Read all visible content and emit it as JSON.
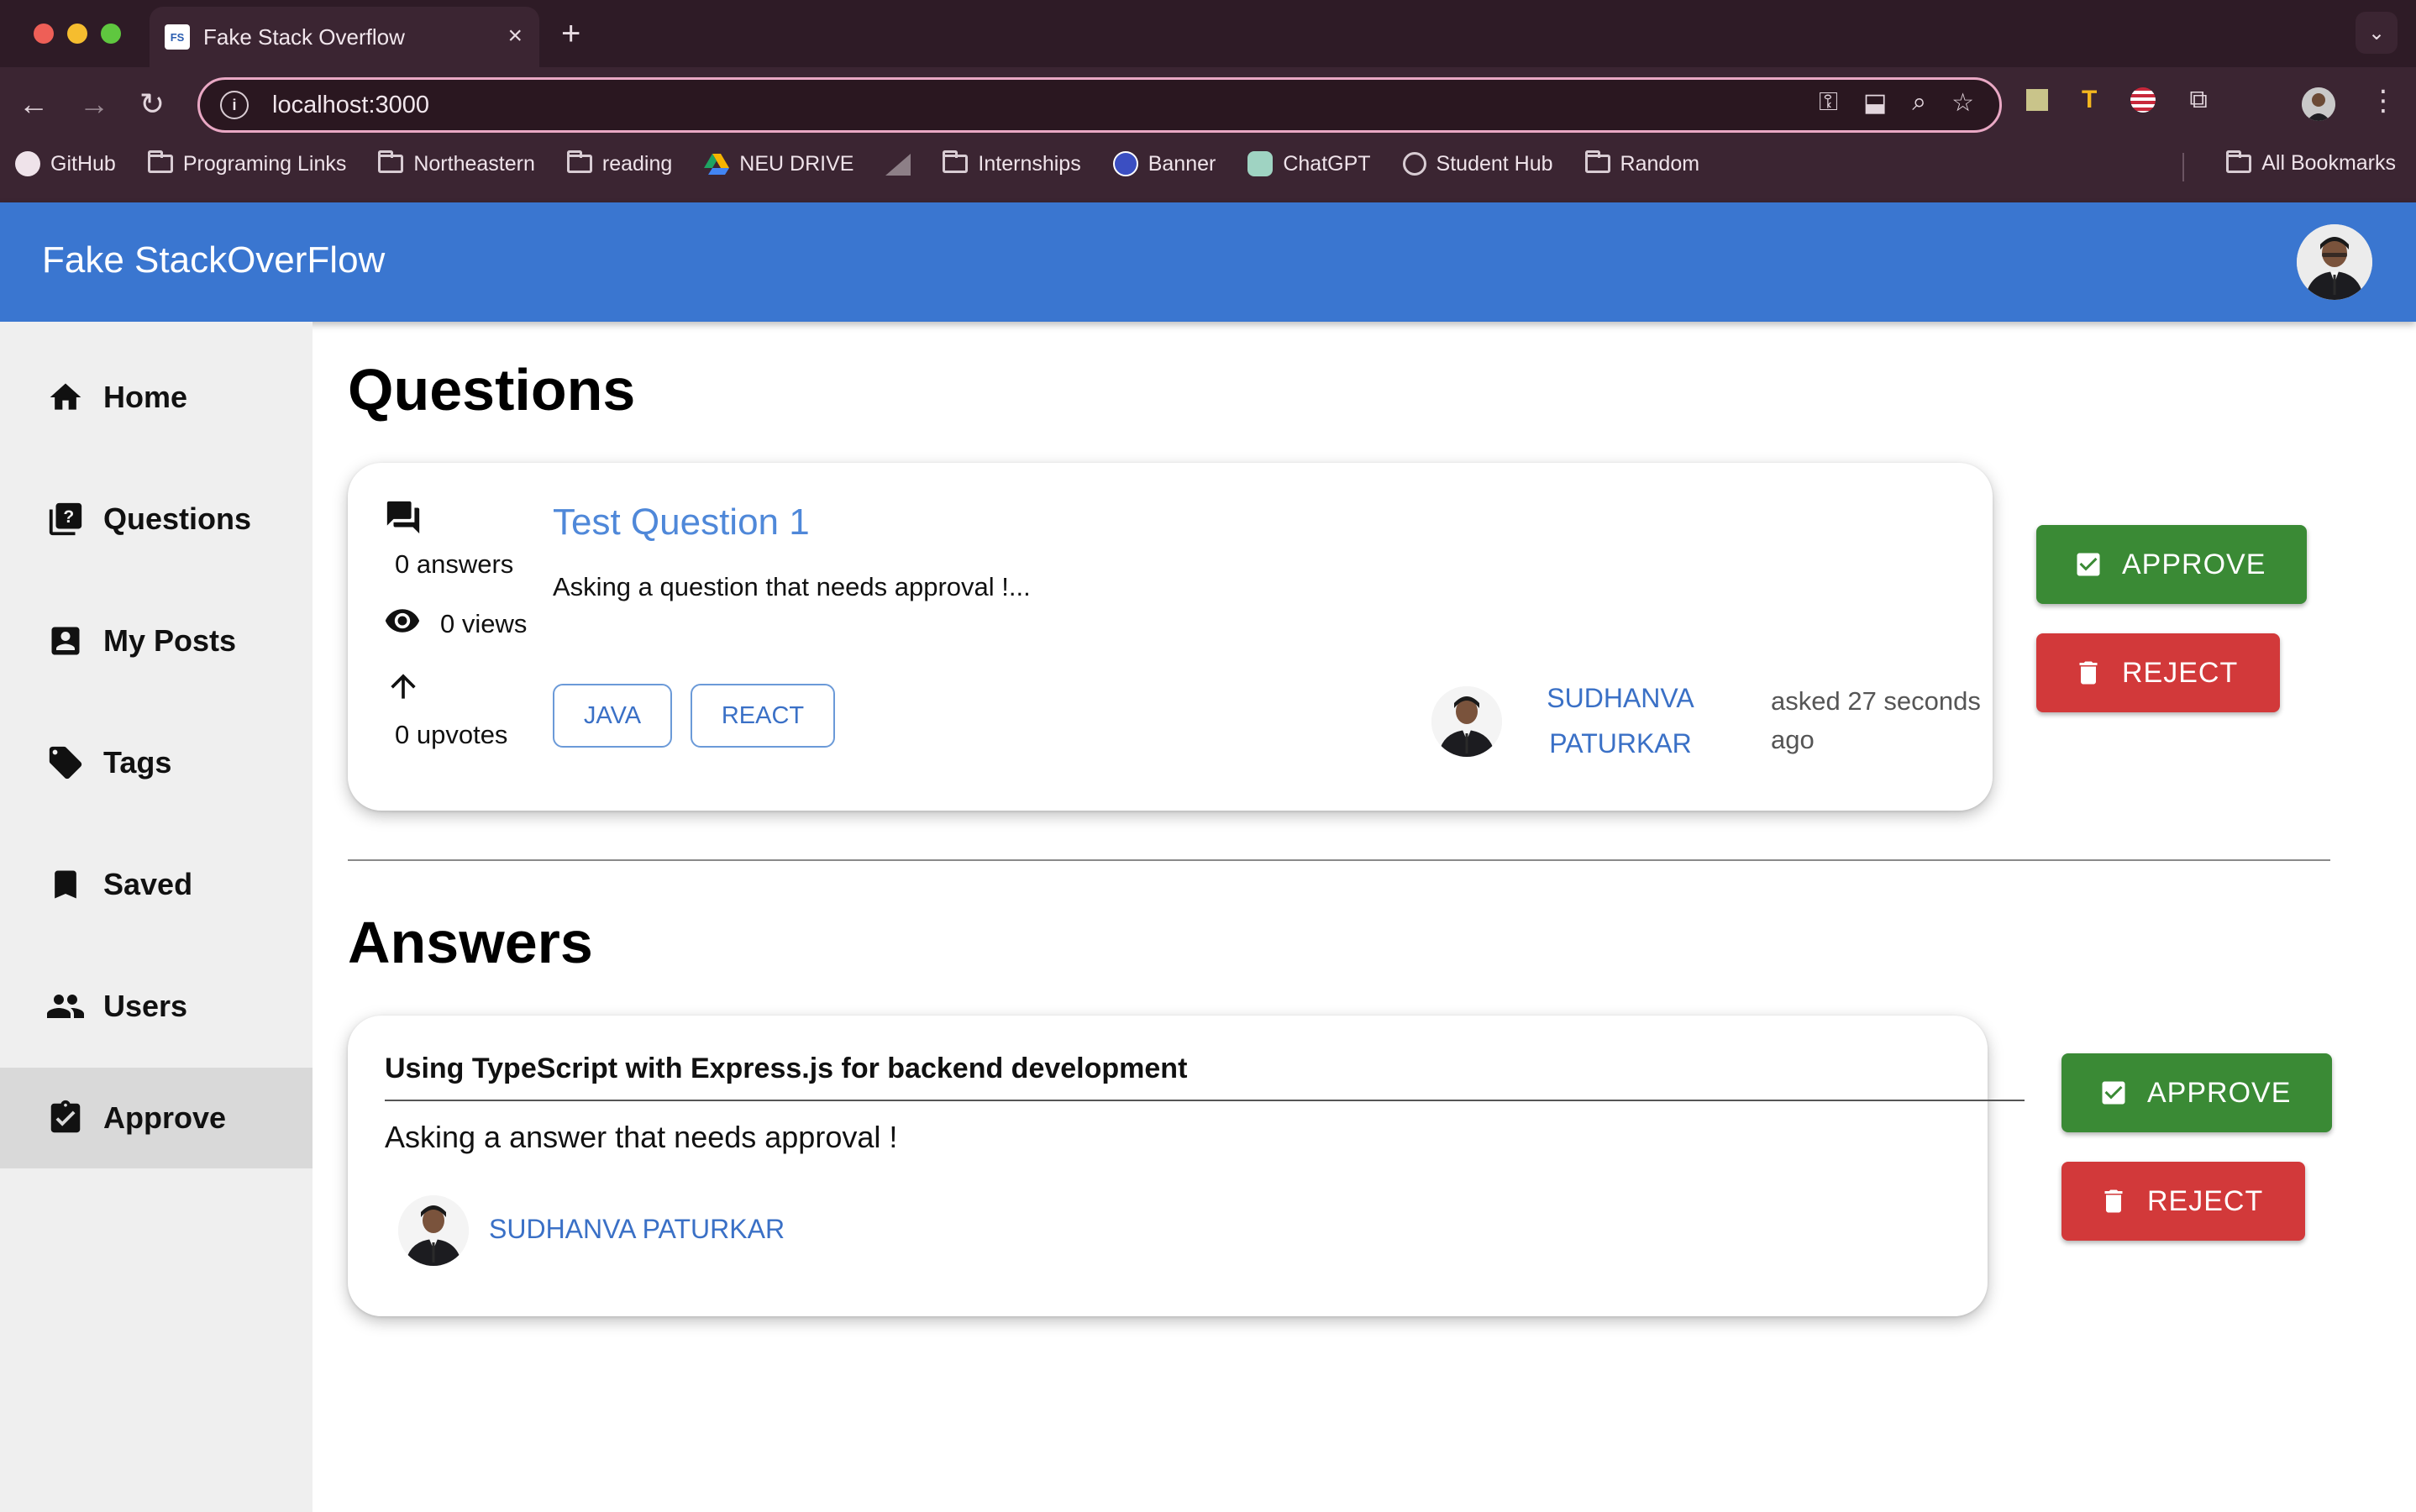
{
  "browser": {
    "tab_title": "Fake Stack Overflow",
    "tab_favicon": "FS",
    "url": "localhost:3000",
    "bookmarks": [
      {
        "label": "GitHub",
        "icon": "github-icon"
      },
      {
        "label": "Programing Links",
        "icon": "folder-icon"
      },
      {
        "label": "Northeastern",
        "icon": "folder-icon"
      },
      {
        "label": "reading",
        "icon": "folder-icon"
      },
      {
        "label": "NEU DRIVE",
        "icon": "drive-icon"
      },
      {
        "label": "",
        "icon": "chart-bookmark-icon"
      },
      {
        "label": "Internships",
        "icon": "folder-icon"
      },
      {
        "label": "Banner",
        "icon": "banner-icon"
      },
      {
        "label": "ChatGPT",
        "icon": "chatgpt-icon"
      },
      {
        "label": "Student Hub",
        "icon": "globe-icon"
      },
      {
        "label": "Random",
        "icon": "folder-icon"
      }
    ],
    "all_bookmarks": "All Bookmarks"
  },
  "app": {
    "brand": "Fake StackOverFlow",
    "accent": "#3a76d0"
  },
  "sidebar": {
    "items": [
      {
        "label": "Home",
        "icon": "home-icon"
      },
      {
        "label": "Questions",
        "icon": "questions-icon"
      },
      {
        "label": "My Posts",
        "icon": "account-box-icon"
      },
      {
        "label": "Tags",
        "icon": "tag-icon"
      },
      {
        "label": "Saved",
        "icon": "bookmark-icon"
      },
      {
        "label": "Users",
        "icon": "people-icon"
      },
      {
        "label": "Approve",
        "icon": "clipboard-check-icon"
      }
    ],
    "active": "Approve"
  },
  "questions_section": {
    "heading": "Questions",
    "items": [
      {
        "answers": "0 answers",
        "views": "0 views",
        "upvotes": "0 upvotes",
        "title": "Test Question 1",
        "text": "Asking a question that needs approval !...",
        "tags": [
          "JAVA",
          "REACT"
        ],
        "author_first": "SUDHANVA",
        "author_last": "PATURKAR",
        "asked_line1": "asked 27 seconds",
        "asked_line2": "ago"
      }
    ]
  },
  "answers_section": {
    "heading": "Answers",
    "items": [
      {
        "question_title": "Using TypeScript with Express.js for backend development",
        "text": "Asking a answer that needs approval !",
        "author": "SUDHANVA PATURKAR"
      }
    ]
  },
  "actions": {
    "approve": "APPROVE",
    "reject": "REJECT",
    "approve_color": "#3a8a35",
    "reject_color": "#d2393a"
  }
}
